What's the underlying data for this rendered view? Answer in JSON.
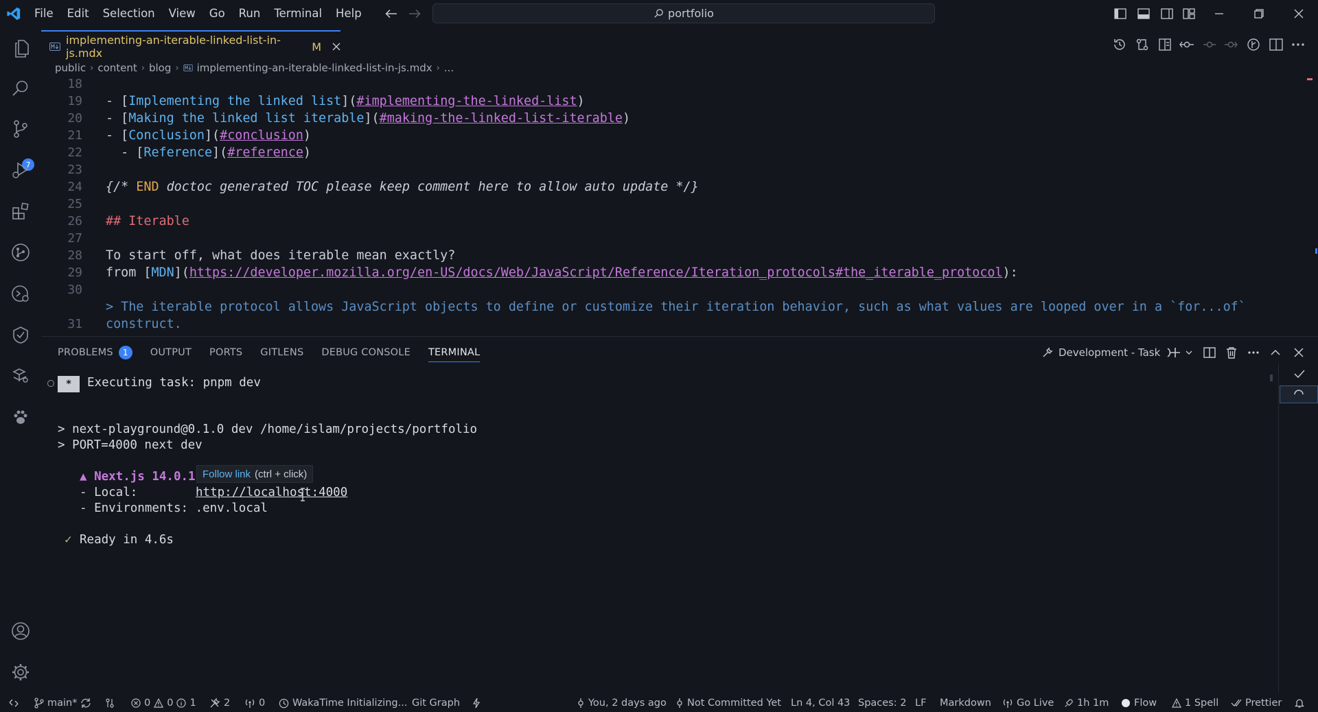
{
  "menu": [
    "File",
    "Edit",
    "Selection",
    "View",
    "Go",
    "Run",
    "Terminal",
    "Help"
  ],
  "search": {
    "text": "portfolio"
  },
  "tab": {
    "label": "implementing-an-iterable-linked-list-in-js.mdx",
    "modified": "M",
    "icon": "markdown-icon"
  },
  "breadcrumb": [
    "public",
    "content",
    "blog",
    "implementing-an-iterable-linked-list-in-js.mdx",
    "..."
  ],
  "editor": {
    "line_numbers": [
      "18",
      "19",
      "20",
      "21",
      "22",
      "23",
      "24",
      "25",
      "26",
      "27",
      "28",
      "29",
      "30",
      "",
      "31"
    ],
    "l18": {
      "prefix": "- ",
      "text": "Implementing the linked list",
      "url": "#implementing-the-linked-list"
    },
    "l19": {
      "prefix": "- ",
      "text": "Making the linked list iterable",
      "url": "#making-the-linked-list-iterable"
    },
    "l20": {
      "prefix": "- ",
      "text": "Conclusion",
      "url": "#conclusion"
    },
    "l21": {
      "prefix": "  - ",
      "text": "Reference",
      "url": "#reference"
    },
    "l23": {
      "open": "{/* ",
      "keyword": "END",
      "comment": " doctoc generated TOC please keep comment here to allow auto update */}"
    },
    "l25": "## Iterable",
    "l27": "To start off, what does iterable mean exactly?",
    "l28": {
      "prefix": "from ",
      "text": "MDN",
      "url": "https://developer.mozilla.org/en-US/docs/Web/JavaScript/Reference/Iteration_protocols#the_iterable_protocol",
      "suffix": ":"
    },
    "l30a": "> The iterable protocol allows JavaScript objects to define or customize their iteration behavior, such as what values are looped over in a `for...of`",
    "l30b": "construct."
  },
  "panel": {
    "tabs": [
      "PROBLEMS",
      "OUTPUT",
      "PORTS",
      "GITLENS",
      "DEBUG CONSOLE",
      "TERMINAL"
    ],
    "problems_count": "1",
    "active_tab": "TERMINAL",
    "task": "Development - Task"
  },
  "terminal": {
    "exec_marker": "*",
    "exec": "Executing task: pnpm dev",
    "cmd1": "> next-playground@0.1.0 dev /home/islam/projects/portfolio",
    "cmd2": "> PORT=4000 next dev",
    "nextjs": "▲ Next.js 14.0.1",
    "local_label": "- Local:",
    "local_url": "http://localhost:4000",
    "env": "- Environments: .env.local",
    "ready_check": "✓",
    "ready": "Ready in 4.6s"
  },
  "tooltip": {
    "link": "Follow link",
    "hint": "(ctrl + click)"
  },
  "status": {
    "branch": "main*",
    "errors": "0",
    "warnings": "0",
    "infos": "1",
    "tools": "2",
    "ports": "0",
    "wakatime": "WakaTime Initializing...",
    "gitgraph": "Git Graph",
    "blame": "You, 2 days ago",
    "commit": "Not Committed Yet",
    "position": "Ln 4, Col 43",
    "spaces": "Spaces: 2",
    "eol": "LF",
    "language": "Markdown",
    "golive": "Go Live",
    "time": "1h 1m",
    "flow": "Flow",
    "spell": "1 Spell",
    "prettier": "Prettier"
  },
  "colors": {
    "accent": "#3b82f6",
    "link": "#5fb3f0",
    "url": "#c678dd",
    "heading": "#e06c75",
    "modified": "#e0c468"
  }
}
